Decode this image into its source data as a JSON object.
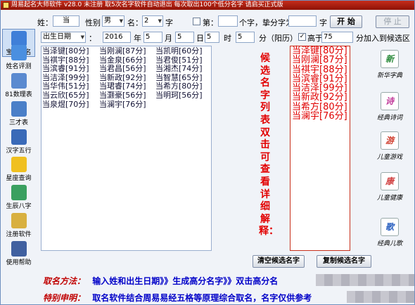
{
  "window": {
    "title": "周易起名大师软件 v28.0  未注册  取5次名字软件自动退出 每次取出100个低分名字 请启买正式版"
  },
  "sidebar": [
    {
      "name": "sidebar-baby-naming",
      "label": "宝宝取名",
      "icon": "baby-icon",
      "color": "#3f7fd8",
      "active": true
    },
    {
      "name": "sidebar-name-score",
      "label": "姓名评测",
      "icon": "people-icon",
      "color": "#4a8fe0",
      "active": false
    },
    {
      "name": "sidebar-81-table",
      "label": "81数理表",
      "icon": "table-grid-icon",
      "color": "#5a8ad0",
      "active": false
    },
    {
      "name": "sidebar-three-talents",
      "label": "三才表",
      "icon": "table-icon",
      "color": "#4a7fc8",
      "active": false
    },
    {
      "name": "sidebar-hanzi-wuxing",
      "label": "汉字五行",
      "icon": "book-icon",
      "color": "#3a6ab8",
      "active": false
    },
    {
      "name": "sidebar-constellation",
      "label": "星座查询",
      "icon": "star-icon",
      "color": "#f0c020",
      "active": false
    },
    {
      "name": "sidebar-bazi",
      "label": "生辰八字",
      "icon": "shirt-icon",
      "color": "#3aa060",
      "active": false
    },
    {
      "name": "sidebar-register",
      "label": "注册软件",
      "icon": "key-icon",
      "color": "#d8b040",
      "active": false
    },
    {
      "name": "sidebar-help",
      "label": "使用帮助",
      "icon": "help-icon",
      "color": "#4060a0",
      "active": false
    }
  ],
  "form": {
    "surname_label": "姓：",
    "surname": "当",
    "gender_label": "性别",
    "gender": "男",
    "name_label": "名：",
    "name_len": "2",
    "zi_label": "字",
    "di_label": "第：",
    "geizi_label": "个字，挚分字为：",
    "zi2_label": "字",
    "start_label": "开  始",
    "stop_label": "停  止",
    "date_type": "出生日期",
    "colon": "：",
    "year": "2016",
    "year_label": "年",
    "month": "5",
    "month_label": "月",
    "day": "5",
    "day_label": "日",
    "hour": "5",
    "hour_label": "时",
    "minute": "5",
    "minute_label": "分（阳历）",
    "above_label": "高于",
    "threshold": "75",
    "add_label": "分加入到候选区"
  },
  "results": {
    "col1": [
      "当泽键[80分]",
      "当祺宇[88分]",
      "当滨睿[91分]",
      "当洁泽[99分]",
      "当华伟[51分]",
      "当云欣[65分]",
      "当泉煜[70分]"
    ],
    "col2": [
      "当刚澜[87分]",
      "当金泉[66分]",
      "当君昌[56分]",
      "当新政[92分]",
      "当珺睿[74分]",
      "当灏豪[56分]",
      "当澜宇[76分]"
    ],
    "col3": [
      "当凯明[60分]",
      "当君俊[51分]",
      "当湘杰[74分]",
      "当智慧[65分]",
      "当希方[80分]",
      "当明珂[56分]"
    ]
  },
  "prompt": "候选名字列表双击可查看详细解释：",
  "candidates": [
    "当泽键[80分]",
    "当刚澜[87分]",
    "当祺宇[88分]",
    "当滨睿[91分]",
    "当洁泽[99分]",
    "当新政[92分]",
    "当希方[80分]",
    "当澜宇[76分]"
  ],
  "rightbar": [
    {
      "name": "xinhua-dict-button",
      "icon": "新",
      "label": "新华字典",
      "color": "#2a8a3a"
    },
    {
      "name": "classic-poetry-button",
      "icon": "诗",
      "label": "经典诗词",
      "color": "#c03a9a"
    },
    {
      "name": "kids-games-button",
      "icon": "游",
      "label": "儿童游戏",
      "color": "#d04030"
    },
    {
      "name": "kids-health-button",
      "icon": "康",
      "label": "儿童健康",
      "color": "#d04040"
    },
    {
      "name": "kids-songs-button",
      "icon": "歌",
      "label": "经典儿歌",
      "color": "#2a60c0"
    }
  ],
  "buttons": {
    "clear": "清空候选名字",
    "copy": "复制候选名字"
  },
  "instructions": {
    "line1_label": "取名方法：",
    "line1": "输入姓和出生日期》》生成高分名字》》双击高分名",
    "line2_label": "特别申明：",
    "line2": "取名软件结合周易易经五格等原理综合取名，名字仅供参考"
  }
}
